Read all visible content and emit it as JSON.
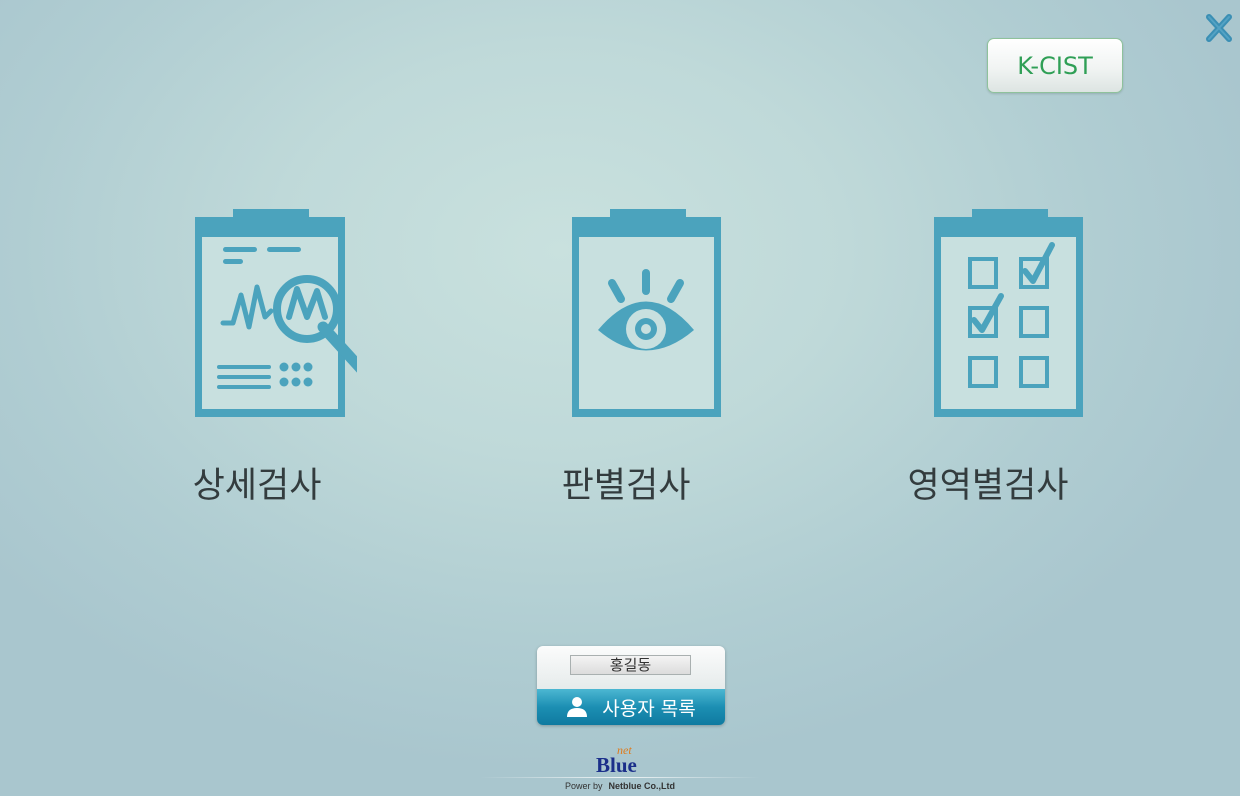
{
  "header": {
    "close_icon": "close-icon",
    "kcist_label": "K-CIST"
  },
  "menu": [
    {
      "label": "상세검사",
      "icon": "clipboard-analysis-icon"
    },
    {
      "label": "판별검사",
      "icon": "clipboard-eye-icon"
    },
    {
      "label": "영역별검사",
      "icon": "clipboard-checklist-icon"
    }
  ],
  "user": {
    "name": "홍길동",
    "list_label": "사용자 목록",
    "list_icon": "person-icon"
  },
  "footer": {
    "logo_small": "net",
    "logo_main": "Blue",
    "power_by": "Power by",
    "company": "Netblue Co.,Ltd"
  },
  "colors": {
    "icon": "#4ba3bd",
    "kcist_text": "#2f9f56",
    "close": "#3b8fb4",
    "user_button": "#1c8fb3"
  }
}
